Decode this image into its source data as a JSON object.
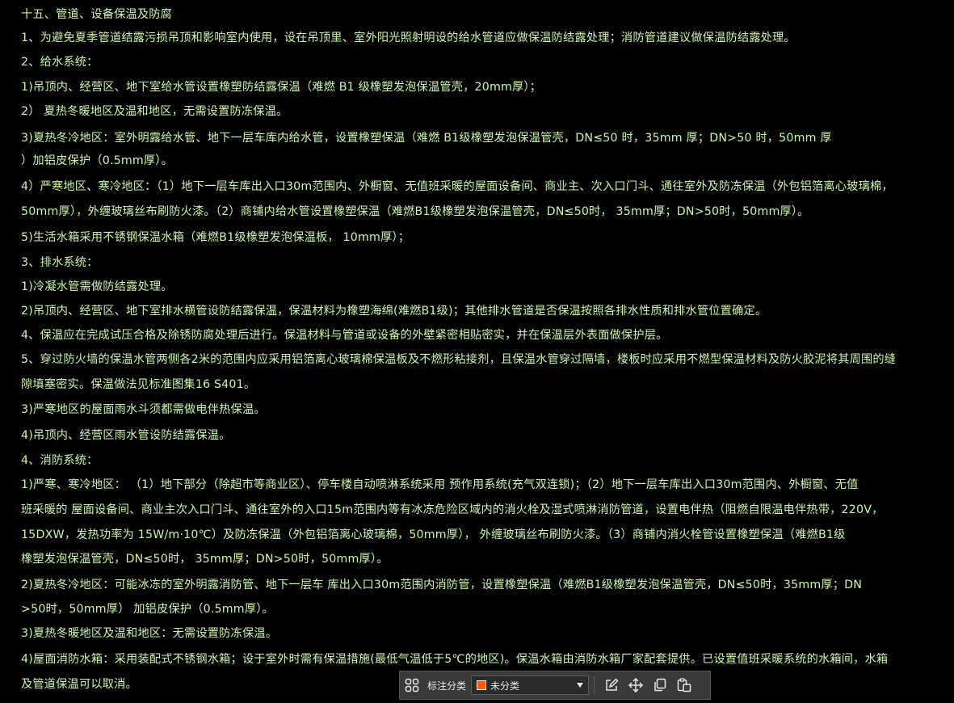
{
  "document": {
    "lines": [
      "十五、管道、设备保温及防腐",
      "1、为避免夏季管道结露污损吊顶和影响室内使用，设在吊顶里、室外阳光照射明设的给水管道应做保温防结露处理；消防管道建议做保温防结露处理。",
      "2、给水系统：",
      "1)吊顶内、经营区、地下室给水管设置橡塑防结露保温（难燃 B1 级橡塑发泡保温管壳，20mm厚）；",
      "2） 夏热冬暖地区及温和地区，无需设置防冻保温。",
      "3)夏热冬冷地区：室外明露给水管、地下一层车库内给水管，设置橡塑保温（难燃 B1级橡塑发泡保温管壳，DN≤50 时，35mm 厚；DN>50 时，50mm 厚",
      "）加铝皮保护（0.5mm厚）。",
      "4）严寒地区、寒冷地区：（1）地下一层车库出入口30m范围内、外橱窗、无值班采暖的屋面设备间、商业主、次入口门斗、通往室外及防冻保温（外包铝箔离心玻璃棉，",
      "50mm厚），外缠玻璃丝布刷防火漆。（2）商铺内给水管设置橡塑保温（难燃B1级橡塑发泡保温管壳，DN≤50时， 35mm厚；DN>50时，50mm厚）。",
      "5)生活水箱采用不锈钢保温水箱（难燃B1级橡塑发泡保温板， 10mm厚）；",
      "3、排水系统：",
      "1)冷凝水管需做防结露处理。",
      "2)吊顶内、经营区、地下室排水横管设防结露保温，保温材料为橡塑海绵(难燃B1级)；其他排水管道是否保温按照各排水性质和排水管位置确定。",
      "4、保温应在完成试压合格及除锈防腐处理后进行。保温材料与管道或设备的外壁紧密相贴密实，并在保温层外表面做保护层。",
      "5、穿过防火墙的保温水管两侧各2米的范围内应采用铝箔离心玻璃棉保温板及不燃形粘接剂，且保温水管穿过隔墙，楼板时应采用不燃型保温材料及防火胶泥将其周围的缝",
      "隙填塞密实。保温做法见标准图集16 S401。",
      "3)严寒地区的屋面雨水斗须都需做电伴热保温。",
      "4)吊顶内、经营区雨水管设防结露保温。",
      "4、消防系统：",
      "1)严寒、寒冷地区：  （1）地下部分（除超市等商业区）、停车楼自动喷淋系统采用 预作用系统(充气双连锁)；（2）地下一层车库出入口30m范围内、外橱窗、无值",
      "班采暖的 屋面设备间、商业主次入口门斗、通往室外的入口15m范围内等有冰冻危险区域内的消火栓及湿式喷淋消防管道，设置电伴热（阻燃自限温电伴热带，220V，",
      "15DXW，发热功率为 15W/m·10℃）及防冻保温（外包铝箔离心玻璃棉，50mm厚），  外缠玻璃丝布刷防火漆。（3）商铺内消火栓管设置橡塑保温（难燃B1级",
      "橡塑发泡保温管壳，DN≤50时， 35mm厚；DN>50时，50mm厚）。",
      "2)夏热冬冷地区：可能冰冻的室外明露消防管、地下一层车 库出入口30m范围内消防管，设置橡塑保温（难燃B1级橡塑发泡保温管壳，DN≤50时，35mm厚；DN",
      ">50时，50mm厚） 加铝皮保护（0.5mm厚）。",
      "3)夏热冬暖地区及温和地区：无需设置防冻保温。",
      "4)屋面消防水箱：采用装配式不锈钢水箱；设于室外时需有保温措施(最低气温低于5℃的地区)。保温水箱由消防水箱厂家配套提供。已设置值班采暖系统的水箱间，水箱",
      "及管道保温可以取消。"
    ]
  },
  "toolbar": {
    "label": "标注分类",
    "select_value": "未分类",
    "swatch_color": "#ff5a00",
    "icons": [
      "grid-icon",
      "edit-icon",
      "move-icon",
      "copy-icon",
      "paste-icon"
    ]
  },
  "colors": {
    "background": "#000000",
    "text": "#c9f7a8",
    "toolbar_bg": "#3a3a3a"
  }
}
